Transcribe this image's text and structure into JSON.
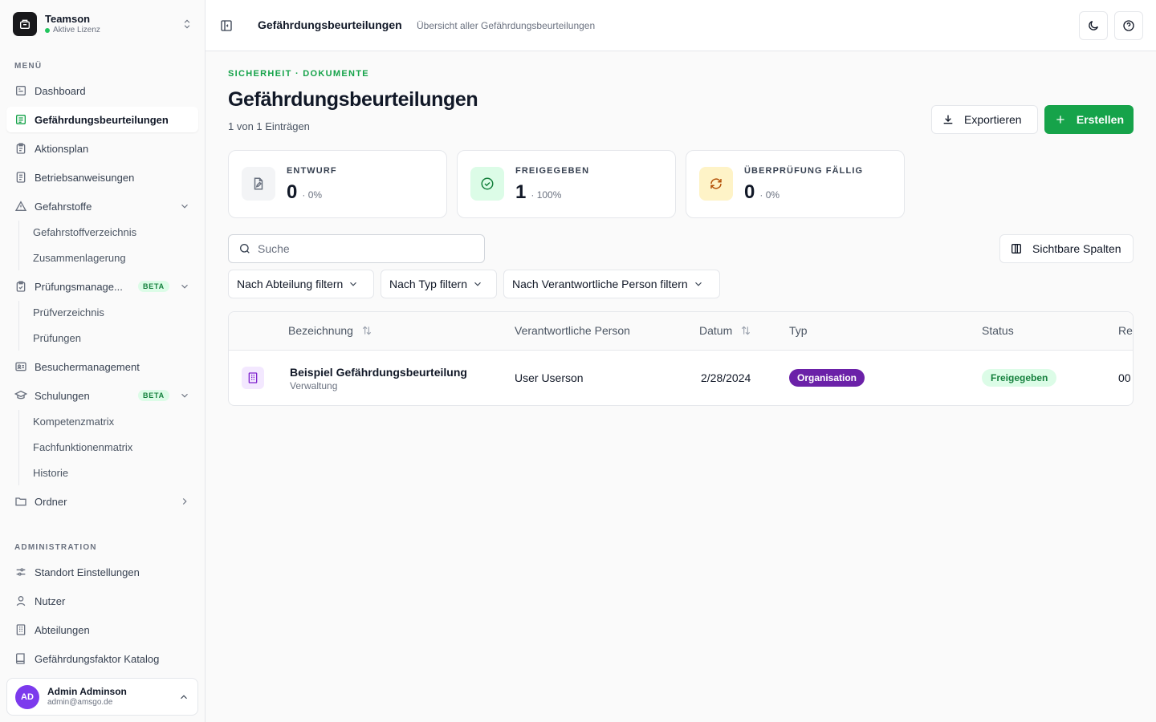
{
  "team": {
    "name": "Teamson",
    "license": "Aktive Lizenz"
  },
  "sidebar": {
    "menu_label": "MENÜ",
    "admin_label": "ADMINISTRATION",
    "items": {
      "dashboard": "Dashboard",
      "gefaehrdung": "Gefährdungsbeurteilungen",
      "aktionsplan": "Aktionsplan",
      "betriebsanweisungen": "Betriebsanweisungen",
      "gefahrstoffe": "Gefahrstoffe",
      "gefahrstoffverzeichnis": "Gefahrstoffverzeichnis",
      "zusammenlagerung": "Zusammenlagerung",
      "pruefung": "Prüfungsmanage...",
      "pruefverzeichnis": "Prüfverzeichnis",
      "pruefungen": "Prüfungen",
      "besucher": "Besuchermanagement",
      "schulungen": "Schulungen",
      "kompetenzmatrix": "Kompetenzmatrix",
      "fachfunktionenmatrix": "Fachfunktionenmatrix",
      "historie": "Historie",
      "ordner": "Ordner",
      "standort": "Standort Einstellungen",
      "nutzer": "Nutzer",
      "abteilungen": "Abteilungen",
      "katalog": "Gefährdungsfaktor Katalog"
    },
    "beta": "BETA"
  },
  "user": {
    "initials": "AD",
    "name": "Admin Adminson",
    "email": "admin@amsgo.de"
  },
  "topbar": {
    "title": "Gefährdungsbeurteilungen",
    "subtitle": "Übersicht aller Gefährdungsbeurteilungen"
  },
  "page": {
    "eyebrow": "SICHERHEIT · DOKUMENTE",
    "title": "Gefährdungsbeurteilungen",
    "count": "1 von 1 Einträgen",
    "export_label": "Exportieren",
    "create_label": "Erstellen"
  },
  "stats": [
    {
      "label": "ENTWURF",
      "value": "0",
      "pct": "· 0%"
    },
    {
      "label": "FREIGEGEBEN",
      "value": "1",
      "pct": "· 100%"
    },
    {
      "label": "ÜBERPRÜFUNG FÄLLIG",
      "value": "0",
      "pct": "· 0%"
    }
  ],
  "search": {
    "placeholder": "Suche"
  },
  "columns_button": "Sichtbare Spalten",
  "filters": [
    "Nach Abteilung filtern",
    "Nach Typ filtern",
    "Nach Verantwortliche Person filtern"
  ],
  "table": {
    "headers": [
      "Bezeichnung",
      "Verantwortliche Person",
      "Datum",
      "Typ",
      "Status",
      "Re"
    ],
    "rows": [
      {
        "name": "Beispiel Gefährdungsbeurteilung",
        "department": "Verwaltung",
        "person": "User Userson",
        "date": "2/28/2024",
        "type": "Organisation",
        "status": "Freigegeben",
        "rev": "00"
      }
    ]
  },
  "colors": {
    "accent": "#16a34a",
    "type_badge": "#6b21a8",
    "status_badge_bg": "#dcfce7"
  }
}
